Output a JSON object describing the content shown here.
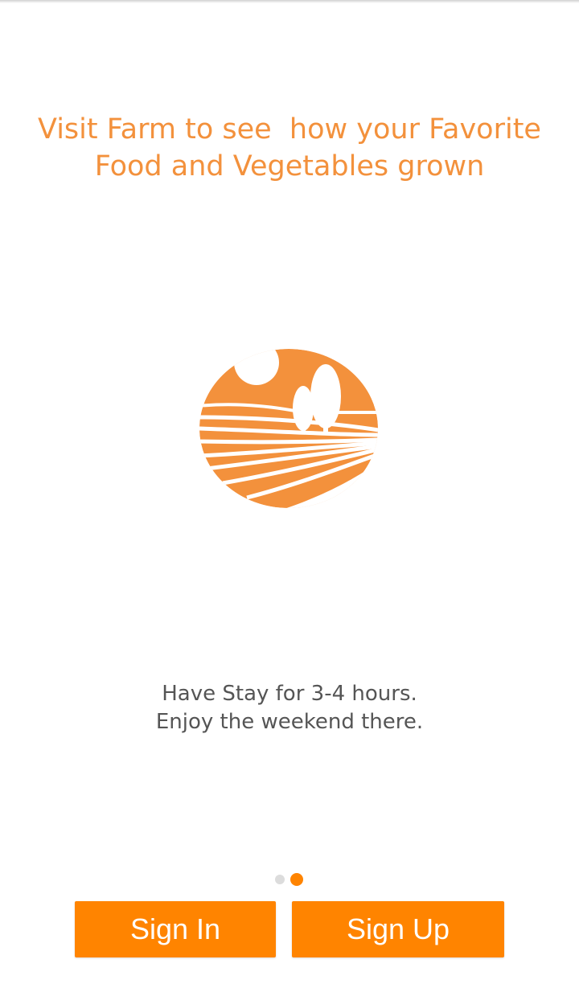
{
  "onboarding": {
    "headline_line1": "Visit Farm to see  how your Favorite",
    "headline_line2": "Food and Vegetables grown",
    "caption_line1": "Have Stay for 3-4 hours.",
    "caption_line2": "Enjoy the weekend there.",
    "logo_icon": "farm-landscape-icon",
    "page_indicator": {
      "total": 2,
      "current": 2
    }
  },
  "actions": {
    "sign_in_label": "Sign In",
    "sign_up_label": "Sign Up"
  },
  "colors": {
    "accent": "#ff8400",
    "headline": "#f3913c",
    "caption": "#555555",
    "dot_inactive": "#dcdcdc"
  }
}
